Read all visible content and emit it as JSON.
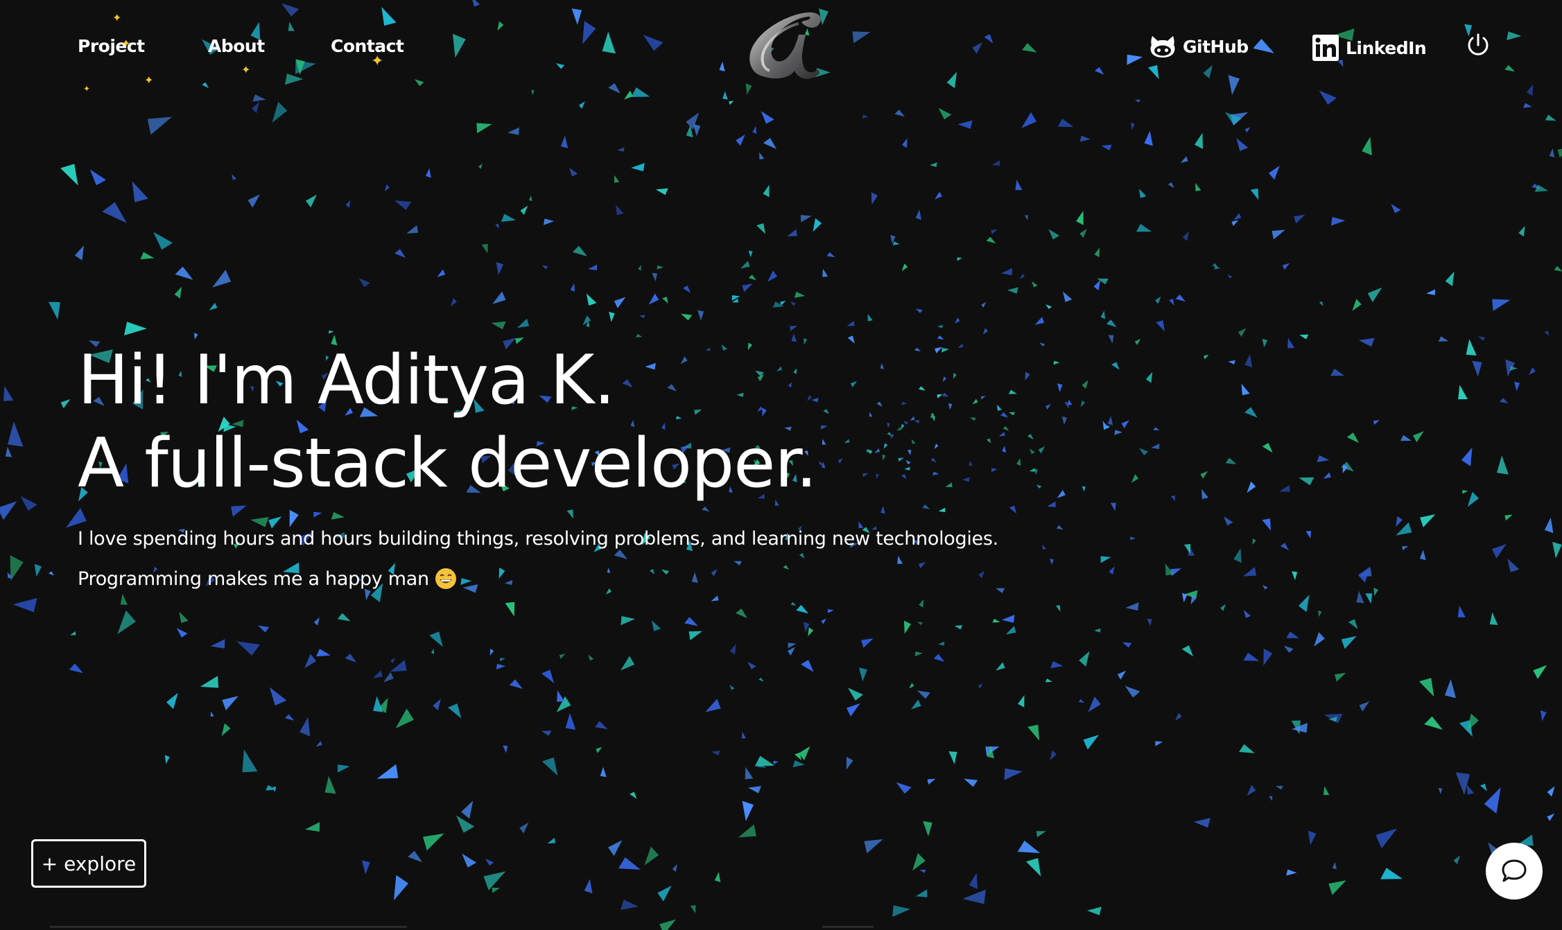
{
  "nav": {
    "links": [
      {
        "label": "Project"
      },
      {
        "label": "About"
      },
      {
        "label": "Contact"
      }
    ]
  },
  "social": {
    "github_label": "GitHub",
    "linkedin_label": "LinkedIn"
  },
  "hero": {
    "line1": "Hi! I'm Aditya K.",
    "line2": "A full-stack developer.",
    "description": "I love spending hours and hours building things, resolving problems, and learning new technologies.",
    "tagline": "Programming makes me a happy man"
  },
  "explore_button": {
    "label": "+ explore"
  },
  "icons": {
    "logo": "alpha-logo-icon",
    "github": "github-icon",
    "linkedin": "linkedin-icon",
    "power": "power-icon",
    "chat": "chat-bubble-icon",
    "emoji": "grinning-face-icon"
  },
  "colors": {
    "background": "#0f0f10",
    "text": "#ffffff",
    "sparkle": "#f7c52b",
    "particle_blue": "#3a6df0",
    "particle_teal": "#2bd4c2",
    "particle_green": "#29c27a"
  }
}
